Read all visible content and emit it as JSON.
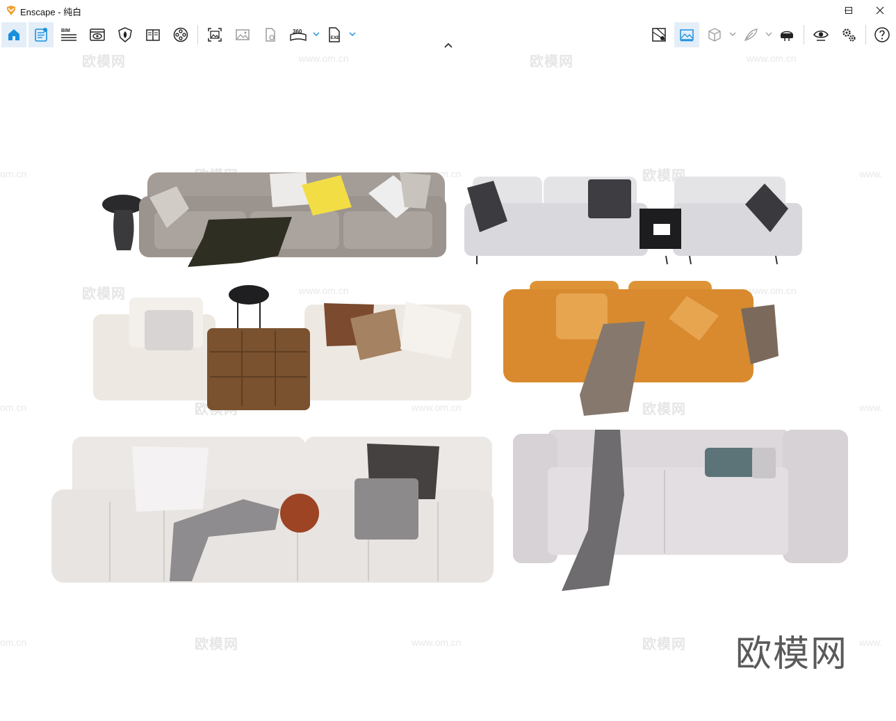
{
  "window": {
    "title": "Enscape - 纯白",
    "controls": [
      "minimize",
      "maximize",
      "close"
    ]
  },
  "toolbar": {
    "left_buttons": [
      {
        "name": "home",
        "icon": "home-icon",
        "active": true
      },
      {
        "name": "assets",
        "icon": "notebook-icon",
        "active": true
      },
      {
        "name": "bim",
        "icon": "bim-icon",
        "label": "BIM"
      },
      {
        "name": "views",
        "icon": "eye-window-icon"
      },
      {
        "name": "atmosphere",
        "icon": "shield-leaf-icon"
      },
      {
        "name": "material-editor",
        "icon": "book-icon"
      },
      {
        "name": "video",
        "icon": "film-reel-icon"
      },
      {
        "name": "screenshot",
        "icon": "screenshot-icon"
      },
      {
        "name": "batch-render",
        "icon": "image-icon"
      },
      {
        "name": "export-file",
        "icon": "file-export-icon"
      },
      {
        "name": "panorama",
        "icon": "panorama-360-icon",
        "label": "360"
      },
      {
        "name": "export-exe",
        "icon": "exe-file-icon",
        "label": "EXE"
      }
    ],
    "right_buttons": [
      {
        "name": "collaborative",
        "icon": "map-pin-icon"
      },
      {
        "name": "visual-settings",
        "icon": "landscape-icon",
        "active": true
      },
      {
        "name": "cube",
        "icon": "cube-icon"
      },
      {
        "name": "feather",
        "icon": "feather-icon"
      },
      {
        "name": "vr-headset",
        "icon": "vr-headset-icon"
      },
      {
        "name": "view-toggle",
        "icon": "eye-icon"
      },
      {
        "name": "settings",
        "icon": "gears-icon"
      },
      {
        "name": "help",
        "icon": "help-icon"
      }
    ]
  },
  "viewport": {
    "watermark_text": "欧模网",
    "watermark_url": "www.om.cn",
    "watermark_url_partial": "om.cn",
    "watermark_url_clipped": "www.",
    "brand_mark": "欧模网"
  },
  "colors": {
    "accent": "#1a8fe0",
    "active_bg": "#e3eef8",
    "sofa_gray": "#9b938d",
    "sofa_light": "#e4e3e6",
    "sofa_cream": "#ede8e2",
    "sofa_orange": "#d98a2e",
    "leather_brown": "#7a5230",
    "pillow_yellow": "#f2dd45"
  }
}
